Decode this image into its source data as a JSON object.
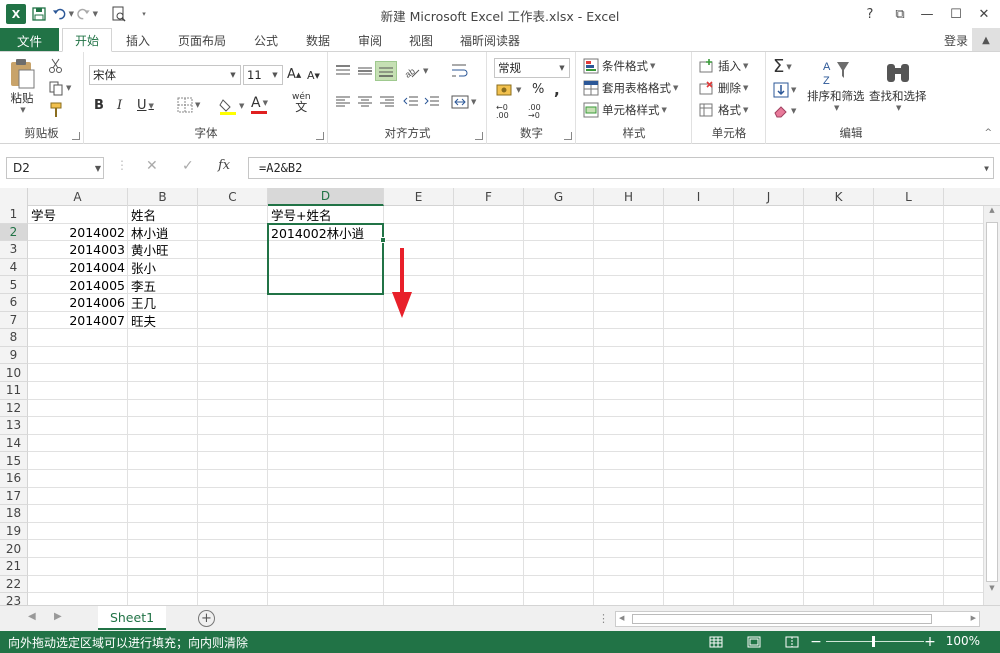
{
  "window": {
    "title": "新建 Microsoft Excel 工作表.xlsx - Excel",
    "controls": [
      "?",
      "⧉",
      "—",
      "☐",
      "✕"
    ]
  },
  "qat": {
    "logo": "X",
    "save": "save-icon",
    "undo": "undo-icon",
    "redo": "redo-icon",
    "preview": "print-preview-icon"
  },
  "tabs": {
    "file": "文件",
    "items": [
      "开始",
      "插入",
      "页面布局",
      "公式",
      "数据",
      "审阅",
      "视图",
      "福昕阅读器"
    ],
    "login": "登录"
  },
  "ribbon": {
    "clipboard": {
      "label": "剪贴板",
      "paste": "粘贴"
    },
    "font": {
      "label": "字体",
      "name": "宋体",
      "size": "11",
      "bold": "B",
      "italic": "I",
      "underline": "U",
      "grow": "A",
      "shrink": "A",
      "wen": "wén",
      "fontcolor": "A",
      "phonetic": "文"
    },
    "align": {
      "label": "对齐方式"
    },
    "number": {
      "label": "数字",
      "format": "常规",
      "percent": "%",
      "comma": ",",
      "dec_inc": "←0 .00",
      "dec_dec": ".00 →0"
    },
    "styles": {
      "label": "样式",
      "cond": "条件格式",
      "table": "套用表格格式",
      "cell": "单元格样式"
    },
    "cells": {
      "label": "单元格",
      "insert": "插入",
      "delete": "删除",
      "format": "格式"
    },
    "edit": {
      "label": "编辑",
      "sum": "Σ",
      "sort": "排序和筛选",
      "find": "查找和选择"
    }
  },
  "formula_bar": {
    "name_box": "D2",
    "cancel": "✕",
    "enter": "✓",
    "fx": "fx",
    "formula": "=A2&B2"
  },
  "grid": {
    "columns": [
      "A",
      "B",
      "C",
      "D",
      "E",
      "F",
      "G",
      "H",
      "I",
      "J",
      "K",
      "L"
    ],
    "selected_column": "D",
    "rows": [
      "1",
      "2",
      "3",
      "4",
      "5",
      "6",
      "7",
      "8",
      "9",
      "10",
      "11",
      "12",
      "13",
      "14",
      "15",
      "16",
      "17",
      "18",
      "19",
      "20",
      "21",
      "22",
      "23"
    ],
    "selected_row": "2",
    "cells": {
      "A1": "学号",
      "B1": "姓名",
      "D1": "学号+姓名",
      "A2": "2014002",
      "B2": "林小逍",
      "D2": "2014002林小逍",
      "A3": "2014003",
      "B3": "黄小旺",
      "A4": "2014004",
      "B4": "张小",
      "A5": "2014005",
      "B5": "李五",
      "A6": "2014006",
      "B6": "王几",
      "A7": "2014007",
      "B7": "旺夫"
    }
  },
  "sheets": {
    "active": "Sheet1",
    "add": "+"
  },
  "status": {
    "message": "向外拖动选定区域可以进行填充；向内则清除",
    "zoom": "100%",
    "zoom_minus": "−",
    "zoom_plus": "+"
  },
  "colors": {
    "accent": "#217346",
    "annotation_arrow": "#e8202a"
  }
}
